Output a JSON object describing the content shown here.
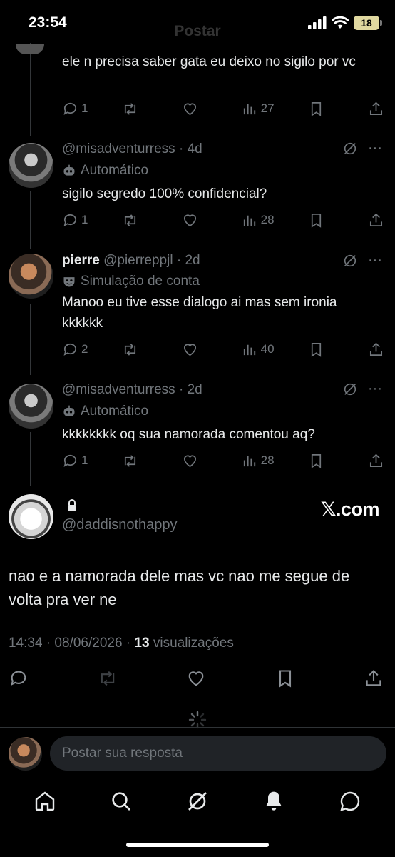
{
  "status_bar": {
    "time": "23:54",
    "battery": "18",
    "faded_title": "Postar"
  },
  "first_reply": {
    "text": "ele n precisa saber  gata eu deixo no sigilo por vc",
    "replies": "1",
    "views": "27"
  },
  "replies": [
    {
      "name": "",
      "handle": "@misadventurress",
      "time": "4d",
      "label_icon": "bot-icon",
      "label": "Automático",
      "text": "sigilo segredo 100% confidencial?",
      "reply_count": "1",
      "views": "28"
    },
    {
      "name": "pierre",
      "handle": "@pierreppjl",
      "time": "2d",
      "label_icon": "mask-icon",
      "label": "Simulação de conta",
      "text": "Manoo eu tive esse dialogo ai mas sem ironia kkkkkk",
      "reply_count": "2",
      "views": "40"
    },
    {
      "name": "",
      "handle": "@misadventurress",
      "time": "2d",
      "label_icon": "bot-icon",
      "label": "Automático",
      "text": "kkkkkkkk oq sua namorada comentou aq?",
      "reply_count": "1",
      "views": "28"
    }
  ],
  "main_tweet": {
    "handle": "@daddisnothappy",
    "brand": "𝕏.com",
    "text": "nao e a namorada dele mas vc nao me segue de volta pra ver ne",
    "timestamp": "14:34 · 08/06/2026 · ",
    "views": "13",
    "views_label": " visualizações"
  },
  "reply_bar": {
    "placeholder": "Postar sua resposta"
  },
  "colors": {
    "background": "#000000",
    "text": "#e7e9ea",
    "muted": "#71767b",
    "divider": "#2f3336"
  }
}
